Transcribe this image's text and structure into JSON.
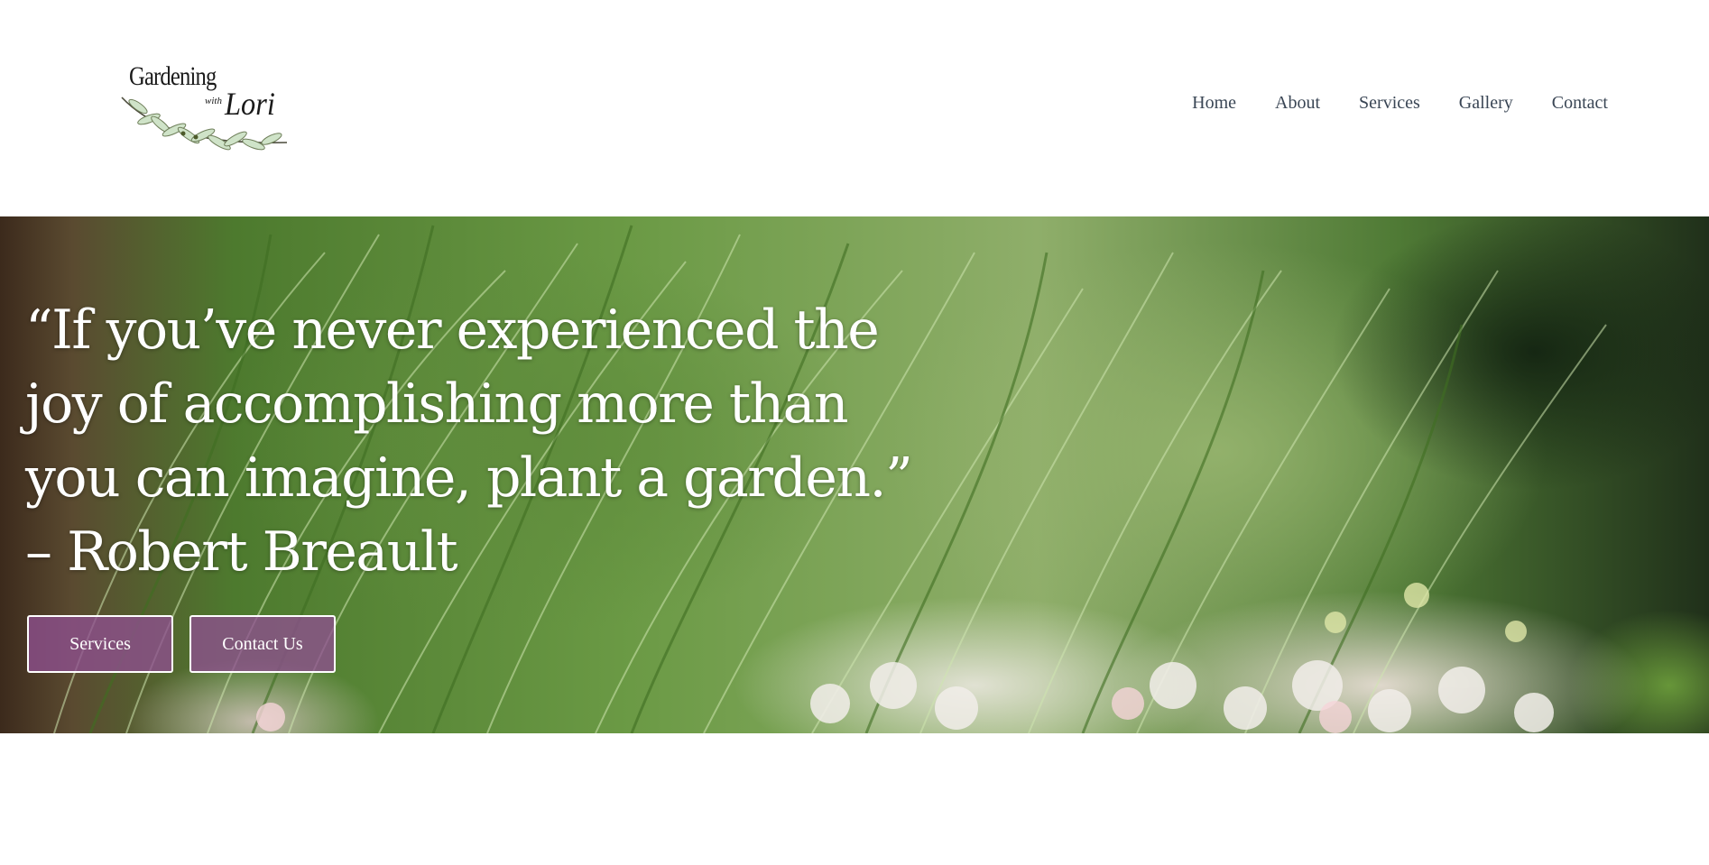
{
  "logo": {
    "line1": "Gardening",
    "line2": "with",
    "line3": "Lori",
    "icon": "olive-branch-icon"
  },
  "nav": {
    "items": [
      "Home",
      "About",
      "Services",
      "Gallery",
      "Contact"
    ]
  },
  "hero": {
    "quote": "“If you’ve never experienced the joy of accomplishing more than you can imagine, plant a garden.” – Robert Breault",
    "buttons": [
      "Services",
      "Contact Us"
    ]
  },
  "colors": {
    "button_bg": "#8e4f8f",
    "nav_text": "#3a4655",
    "hero_text": "#ffffff"
  }
}
